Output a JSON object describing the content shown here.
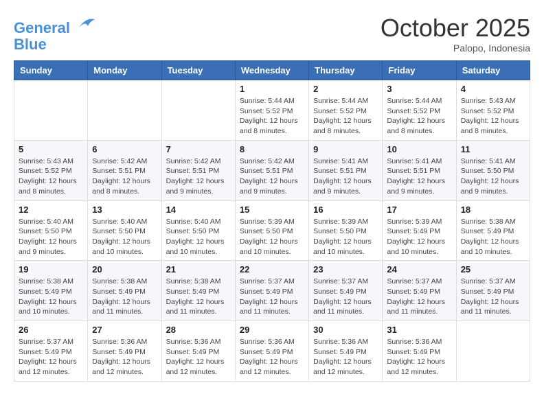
{
  "header": {
    "logo_line1": "General",
    "logo_line2": "Blue",
    "month": "October 2025",
    "location": "Palopo, Indonesia"
  },
  "days_of_week": [
    "Sunday",
    "Monday",
    "Tuesday",
    "Wednesday",
    "Thursday",
    "Friday",
    "Saturday"
  ],
  "weeks": [
    [
      {
        "day": "",
        "info": ""
      },
      {
        "day": "",
        "info": ""
      },
      {
        "day": "",
        "info": ""
      },
      {
        "day": "1",
        "info": "Sunrise: 5:44 AM\nSunset: 5:52 PM\nDaylight: 12 hours\nand 8 minutes."
      },
      {
        "day": "2",
        "info": "Sunrise: 5:44 AM\nSunset: 5:52 PM\nDaylight: 12 hours\nand 8 minutes."
      },
      {
        "day": "3",
        "info": "Sunrise: 5:44 AM\nSunset: 5:52 PM\nDaylight: 12 hours\nand 8 minutes."
      },
      {
        "day": "4",
        "info": "Sunrise: 5:43 AM\nSunset: 5:52 PM\nDaylight: 12 hours\nand 8 minutes."
      }
    ],
    [
      {
        "day": "5",
        "info": "Sunrise: 5:43 AM\nSunset: 5:52 PM\nDaylight: 12 hours\nand 8 minutes."
      },
      {
        "day": "6",
        "info": "Sunrise: 5:42 AM\nSunset: 5:51 PM\nDaylight: 12 hours\nand 8 minutes."
      },
      {
        "day": "7",
        "info": "Sunrise: 5:42 AM\nSunset: 5:51 PM\nDaylight: 12 hours\nand 9 minutes."
      },
      {
        "day": "8",
        "info": "Sunrise: 5:42 AM\nSunset: 5:51 PM\nDaylight: 12 hours\nand 9 minutes."
      },
      {
        "day": "9",
        "info": "Sunrise: 5:41 AM\nSunset: 5:51 PM\nDaylight: 12 hours\nand 9 minutes."
      },
      {
        "day": "10",
        "info": "Sunrise: 5:41 AM\nSunset: 5:51 PM\nDaylight: 12 hours\nand 9 minutes."
      },
      {
        "day": "11",
        "info": "Sunrise: 5:41 AM\nSunset: 5:50 PM\nDaylight: 12 hours\nand 9 minutes."
      }
    ],
    [
      {
        "day": "12",
        "info": "Sunrise: 5:40 AM\nSunset: 5:50 PM\nDaylight: 12 hours\nand 9 minutes."
      },
      {
        "day": "13",
        "info": "Sunrise: 5:40 AM\nSunset: 5:50 PM\nDaylight: 12 hours\nand 10 minutes."
      },
      {
        "day": "14",
        "info": "Sunrise: 5:40 AM\nSunset: 5:50 PM\nDaylight: 12 hours\nand 10 minutes."
      },
      {
        "day": "15",
        "info": "Sunrise: 5:39 AM\nSunset: 5:50 PM\nDaylight: 12 hours\nand 10 minutes."
      },
      {
        "day": "16",
        "info": "Sunrise: 5:39 AM\nSunset: 5:50 PM\nDaylight: 12 hours\nand 10 minutes."
      },
      {
        "day": "17",
        "info": "Sunrise: 5:39 AM\nSunset: 5:49 PM\nDaylight: 12 hours\nand 10 minutes."
      },
      {
        "day": "18",
        "info": "Sunrise: 5:38 AM\nSunset: 5:49 PM\nDaylight: 12 hours\nand 10 minutes."
      }
    ],
    [
      {
        "day": "19",
        "info": "Sunrise: 5:38 AM\nSunset: 5:49 PM\nDaylight: 12 hours\nand 10 minutes."
      },
      {
        "day": "20",
        "info": "Sunrise: 5:38 AM\nSunset: 5:49 PM\nDaylight: 12 hours\nand 11 minutes."
      },
      {
        "day": "21",
        "info": "Sunrise: 5:38 AM\nSunset: 5:49 PM\nDaylight: 12 hours\nand 11 minutes."
      },
      {
        "day": "22",
        "info": "Sunrise: 5:37 AM\nSunset: 5:49 PM\nDaylight: 12 hours\nand 11 minutes."
      },
      {
        "day": "23",
        "info": "Sunrise: 5:37 AM\nSunset: 5:49 PM\nDaylight: 12 hours\nand 11 minutes."
      },
      {
        "day": "24",
        "info": "Sunrise: 5:37 AM\nSunset: 5:49 PM\nDaylight: 12 hours\nand 11 minutes."
      },
      {
        "day": "25",
        "info": "Sunrise: 5:37 AM\nSunset: 5:49 PM\nDaylight: 12 hours\nand 11 minutes."
      }
    ],
    [
      {
        "day": "26",
        "info": "Sunrise: 5:37 AM\nSunset: 5:49 PM\nDaylight: 12 hours\nand 12 minutes."
      },
      {
        "day": "27",
        "info": "Sunrise: 5:36 AM\nSunset: 5:49 PM\nDaylight: 12 hours\nand 12 minutes."
      },
      {
        "day": "28",
        "info": "Sunrise: 5:36 AM\nSunset: 5:49 PM\nDaylight: 12 hours\nand 12 minutes."
      },
      {
        "day": "29",
        "info": "Sunrise: 5:36 AM\nSunset: 5:49 PM\nDaylight: 12 hours\nand 12 minutes."
      },
      {
        "day": "30",
        "info": "Sunrise: 5:36 AM\nSunset: 5:49 PM\nDaylight: 12 hours\nand 12 minutes."
      },
      {
        "day": "31",
        "info": "Sunrise: 5:36 AM\nSunset: 5:49 PM\nDaylight: 12 hours\nand 12 minutes."
      },
      {
        "day": "",
        "info": ""
      }
    ]
  ]
}
